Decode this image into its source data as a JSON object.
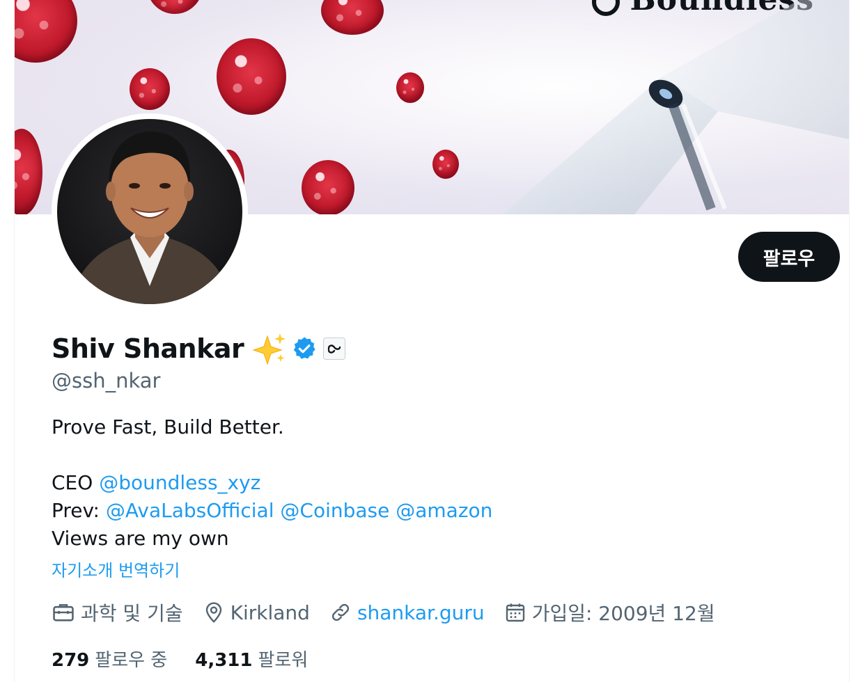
{
  "banner": {
    "logo_text": "Boundless"
  },
  "profile": {
    "display_name": "Shiv Shankar",
    "handle": "@ssh_nkar",
    "follow_label": "팔로우"
  },
  "bio": {
    "line1": "Prove Fast, Build Better.",
    "ceo_prefix": "CEO ",
    "ceo_mention": "@boundless_xyz",
    "prev_prefix": "Prev: ",
    "prev_mentions": [
      "@AvaLabsOfficial",
      "@Coinbase",
      "@amazon"
    ],
    "line_views": "Views are my own",
    "translate_label": "자기소개 번역하기"
  },
  "meta": {
    "category": "과학 및 기술",
    "location": "Kirkland",
    "website": "shankar.guru",
    "joined": "가입일: 2009년 12월"
  },
  "stats": {
    "following_count": "279",
    "following_label": "팔로우 중",
    "followers_count": "4,311",
    "followers_label": "팔로워"
  },
  "colors": {
    "accent": "#1d9bf0",
    "text": "#0f1419",
    "secondary_text": "#536471",
    "follow_button_bg": "#0f1419"
  },
  "icons": {
    "category": "briefcase-icon",
    "location": "map-pin-icon",
    "website": "link-icon",
    "joined": "calendar-icon",
    "verified": "verified-badge-icon",
    "emoji": "sparkles-icon",
    "affiliate": "affiliate-logo-icon"
  }
}
